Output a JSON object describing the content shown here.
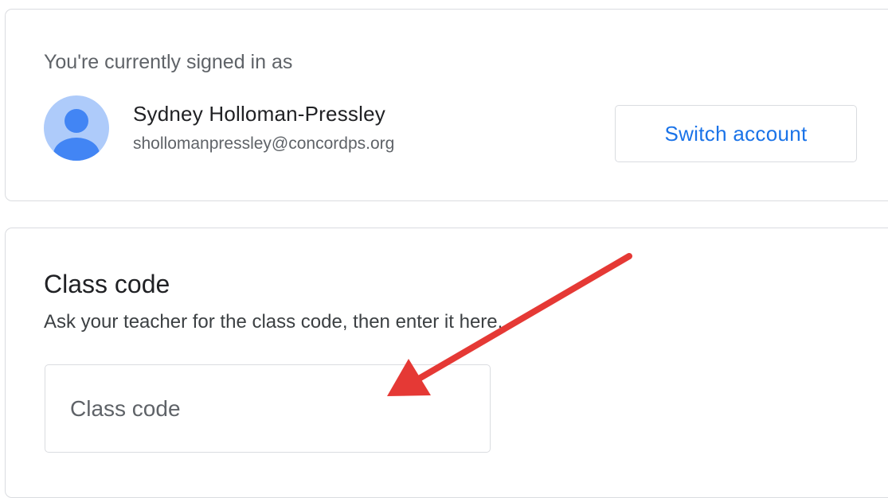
{
  "account": {
    "signed_in_label": "You're currently signed in as",
    "avatar_icon": "account-circle-icon",
    "user_name": "Sydney Holloman-Pressley",
    "user_email": "shollomanpressley@concordps.org",
    "switch_label": "Switch account"
  },
  "class_code": {
    "title": "Class code",
    "instructions": "Ask your teacher for the class code, then enter it here.",
    "input_value": "",
    "input_placeholder": "Class code"
  },
  "annotation": {
    "arrow_color": "#e53935"
  },
  "colors": {
    "accent": "#1a73e8",
    "avatar_background": "#aecbfa",
    "avatar_figure": "#4285f4",
    "border": "#dadce0"
  }
}
